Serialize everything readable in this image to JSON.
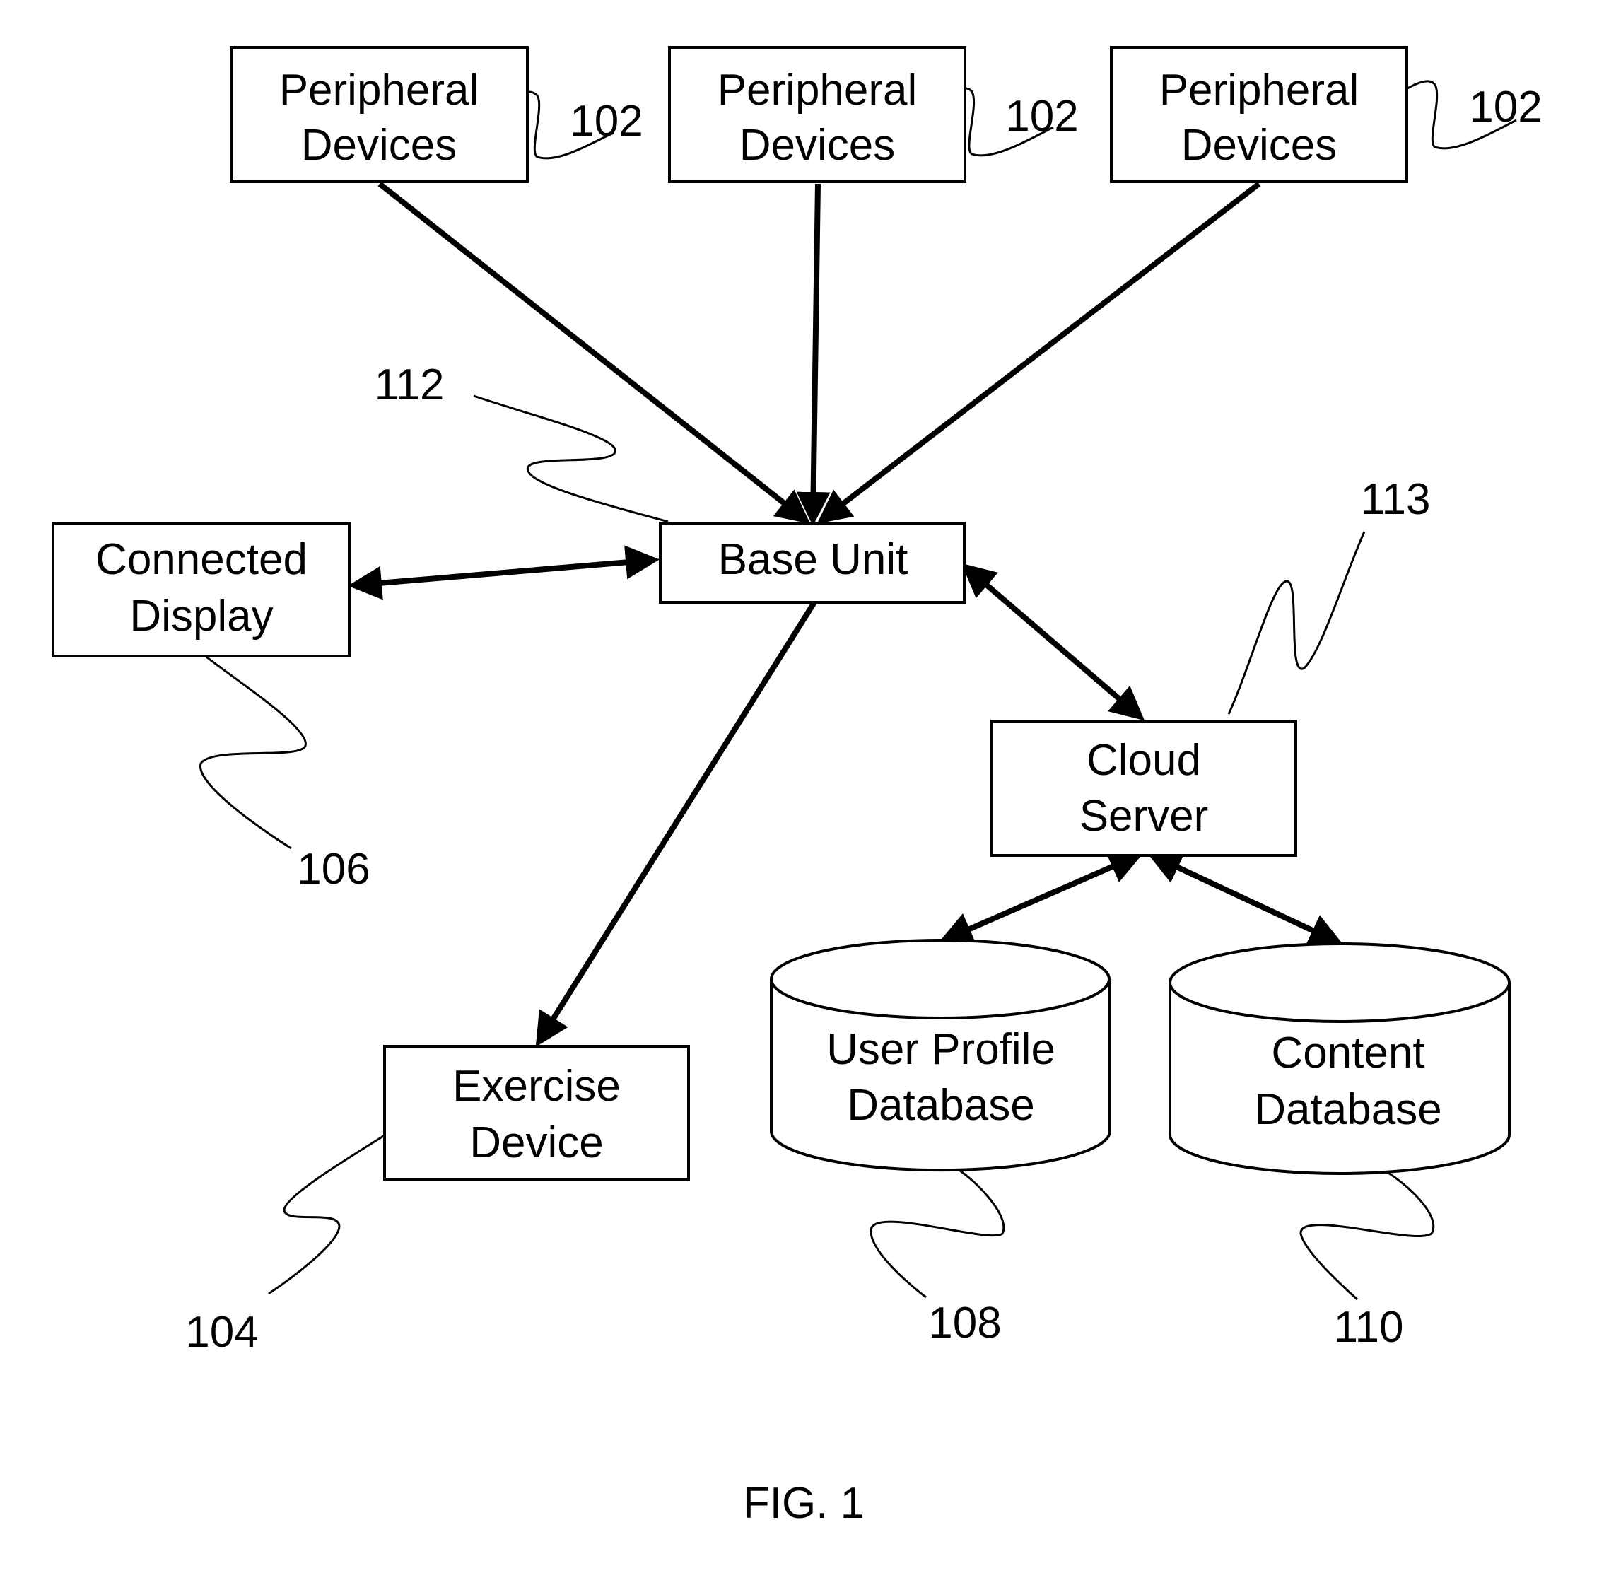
{
  "figure": {
    "caption": "FIG. 1",
    "nodes": {
      "peripheral_1": {
        "line1": "Peripheral",
        "line2": "Devices",
        "ref": "102"
      },
      "peripheral_2": {
        "line1": "Peripheral",
        "line2": "Devices",
        "ref": "102"
      },
      "peripheral_3": {
        "line1": "Peripheral",
        "line2": "Devices",
        "ref": "102"
      },
      "base_unit": {
        "line1": "Base Unit",
        "ref": "112"
      },
      "connected_display": {
        "line1": "Connected",
        "line2": "Display",
        "ref": "106"
      },
      "cloud_server": {
        "line1": "Cloud",
        "line2": "Server",
        "ref": "113"
      },
      "exercise_device": {
        "line1": "Exercise",
        "line2": "Device",
        "ref": "104"
      },
      "user_profile_db": {
        "line1": "User Profile",
        "line2": "Database",
        "ref": "108"
      },
      "content_db": {
        "line1": "Content",
        "line2": "Database",
        "ref": "110"
      }
    },
    "edges": [
      {
        "from": "peripheral_1",
        "to": "base_unit",
        "direction": "to"
      },
      {
        "from": "peripheral_2",
        "to": "base_unit",
        "direction": "to"
      },
      {
        "from": "peripheral_3",
        "to": "base_unit",
        "direction": "to"
      },
      {
        "from": "base_unit",
        "to": "connected_display",
        "direction": "both"
      },
      {
        "from": "base_unit",
        "to": "cloud_server",
        "direction": "both"
      },
      {
        "from": "base_unit",
        "to": "exercise_device",
        "direction": "to"
      },
      {
        "from": "cloud_server",
        "to": "user_profile_db",
        "direction": "both"
      },
      {
        "from": "cloud_server",
        "to": "content_db",
        "direction": "both"
      }
    ]
  }
}
